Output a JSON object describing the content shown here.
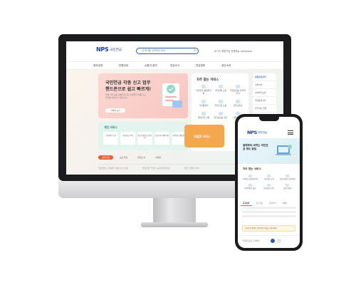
{
  "desktop": {
    "logo": {
      "mark": "NPS",
      "name": "국민연금"
    },
    "search": {
      "placeholder": "검색어를 입력해주세요"
    },
    "util": "로그인 회원가입 전체메뉴 Language",
    "nav": [
      "정보공개",
      "민원안내",
      "소통과 참여",
      "연금소식",
      "연금정보",
      "공단소개"
    ],
    "promo": {
      "title": "국민연금 각종 신고 업무 핸드폰으로 쉽고 빠르게!",
      "desc": "언제, 어디서든 모바일기기로 국민연금 각종 신고 업무를 처리할 수 있습니다",
      "button": "자세히 보기"
    },
    "freq": {
      "title": "자주 찾는 서비스",
      "items": [
        "국민연금 예상연금액",
        "가입내역 조회",
        "연금보험료 납부확인서",
        "가입증명서",
        "연금수령 조회",
        "실업크레딧",
        "임의가입 신청",
        "연금보험료 환급",
        "사업장 조회"
      ]
    },
    "side": [
      "회원정보관리",
      "민원서식",
      "사이버홍보관",
      "연금용어사전",
      "자주하는 질문",
      "고객의 소리"
    ],
    "personal": {
      "title": "개인 서비스",
      "items": [
        "가입내역 조회",
        "연금지급 내역",
        "연금보험료 납부확인",
        "연금수령 계좌변경",
        "국민연금 예상연금"
      ]
    },
    "biz": "사업장 서비스",
    "tabs": [
      "공지사항",
      "보도자료",
      "연금소식",
      "이벤트"
    ],
    "notice": [
      "국민연금 고객센터 운영시간 안내",
      "국민연금 가입자 공지사항 안내",
      "연금 지급일 안내"
    ]
  },
  "mobile": {
    "logo": {
      "mark": "NPS",
      "name": "국민연금"
    },
    "banner": "올해부터 바뀌는 국민연금 제도 알림",
    "freq": {
      "title": "자주 찾는 서비스",
      "items": [
        "국민연금 예상연금액",
        "가입내역 조회",
        "연금보험료 납부확인",
        "가입증명서 발급",
        "연금지급 내역",
        "실업크레딧"
      ]
    },
    "tabs": [
      "공지사항",
      "보도자료",
      "연금소식",
      "이벤트"
    ],
    "promo": "국민연금 앱에서 간편하게 민원을 신청하세요",
    "bottom": "국민연금공단 고객센터"
  },
  "colors": {
    "brand_navy": "#1d3c8f",
    "brand_orange": "#f08a1c",
    "promo_pink": "#f8c6c0",
    "mint": "#e3f4ef",
    "biz_orange": "#f4a74d",
    "tab_active": "#e9603a"
  },
  "icons": [
    "search-icon",
    "menu-icon",
    "document-icon",
    "check-icon"
  ]
}
